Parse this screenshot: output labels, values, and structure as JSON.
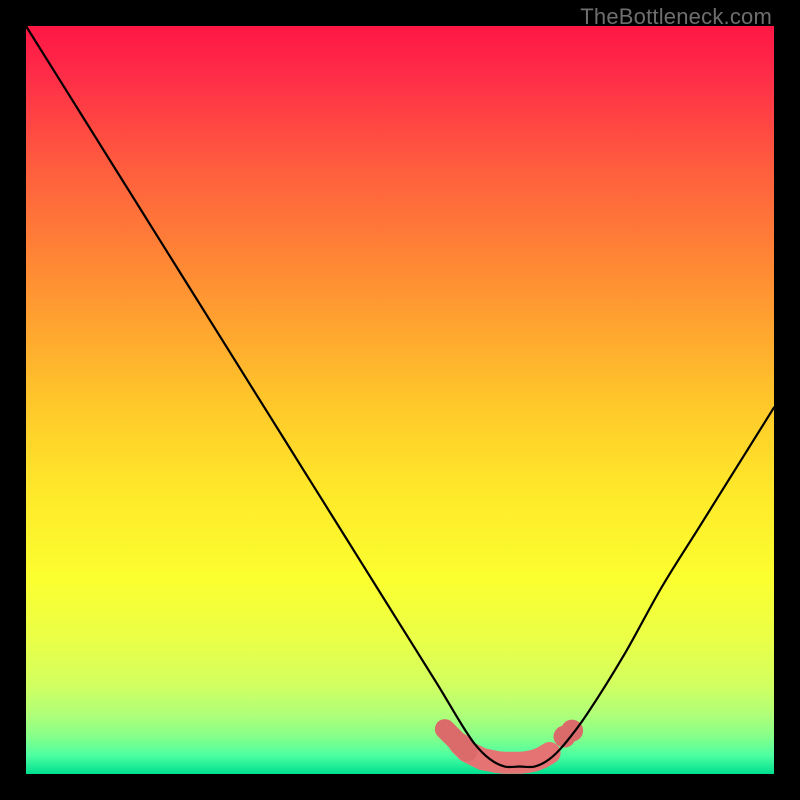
{
  "watermark": "TheBottleneck.com",
  "colors": {
    "black": "#000000",
    "curve": "#000000",
    "marker_fill": "#e57373",
    "marker_fill2": "#db6a6a",
    "gradient_stops": [
      {
        "offset": 0.0,
        "color": "#ff1744"
      },
      {
        "offset": 0.06,
        "color": "#ff2a48"
      },
      {
        "offset": 0.18,
        "color": "#ff5a3f"
      },
      {
        "offset": 0.34,
        "color": "#ff8f33"
      },
      {
        "offset": 0.5,
        "color": "#ffc62a"
      },
      {
        "offset": 0.62,
        "color": "#ffe82a"
      },
      {
        "offset": 0.74,
        "color": "#fbff2f"
      },
      {
        "offset": 0.82,
        "color": "#eaff47"
      },
      {
        "offset": 0.88,
        "color": "#d2ff60"
      },
      {
        "offset": 0.92,
        "color": "#b0ff78"
      },
      {
        "offset": 0.95,
        "color": "#86ff8a"
      },
      {
        "offset": 0.975,
        "color": "#4dffa0"
      },
      {
        "offset": 1.0,
        "color": "#00e090"
      }
    ]
  },
  "chart_data": {
    "type": "line",
    "title": "",
    "xlabel": "",
    "ylabel": "",
    "xlim": [
      0,
      100
    ],
    "ylim": [
      0,
      100
    ],
    "grid": false,
    "legend": false,
    "series": [
      {
        "name": "bottleneck-curve",
        "x": [
          0,
          5,
          10,
          15,
          20,
          25,
          30,
          35,
          40,
          45,
          50,
          55,
          58,
          60,
          62,
          64,
          66,
          68,
          70,
          72,
          75,
          80,
          85,
          90,
          95,
          100
        ],
        "values": [
          100,
          92,
          84,
          76,
          68,
          60,
          52,
          44,
          36,
          28,
          20,
          12,
          7,
          4,
          2,
          1,
          1,
          1,
          2,
          4,
          8,
          16,
          25,
          33,
          41,
          49
        ]
      }
    ],
    "annotations": {
      "optimal_range_x": [
        56,
        73
      ],
      "optimal_range_y": [
        1,
        5
      ],
      "marker_cluster": [
        {
          "x": 56,
          "y": 6
        },
        {
          "x": 57,
          "y": 5
        },
        {
          "x": 58,
          "y": 4
        },
        {
          "x": 59,
          "y": 3
        },
        {
          "x": 60,
          "y": 2.5
        },
        {
          "x": 61,
          "y": 2
        },
        {
          "x": 62,
          "y": 1.8
        },
        {
          "x": 63,
          "y": 1.6
        },
        {
          "x": 64,
          "y": 1.5
        },
        {
          "x": 65,
          "y": 1.5
        },
        {
          "x": 66,
          "y": 1.5
        },
        {
          "x": 67,
          "y": 1.6
        },
        {
          "x": 68,
          "y": 1.8
        },
        {
          "x": 69,
          "y": 2.2
        },
        {
          "x": 70,
          "y": 2.8
        },
        {
          "x": 72,
          "y": 5.0
        },
        {
          "x": 73,
          "y": 5.8
        }
      ]
    }
  }
}
